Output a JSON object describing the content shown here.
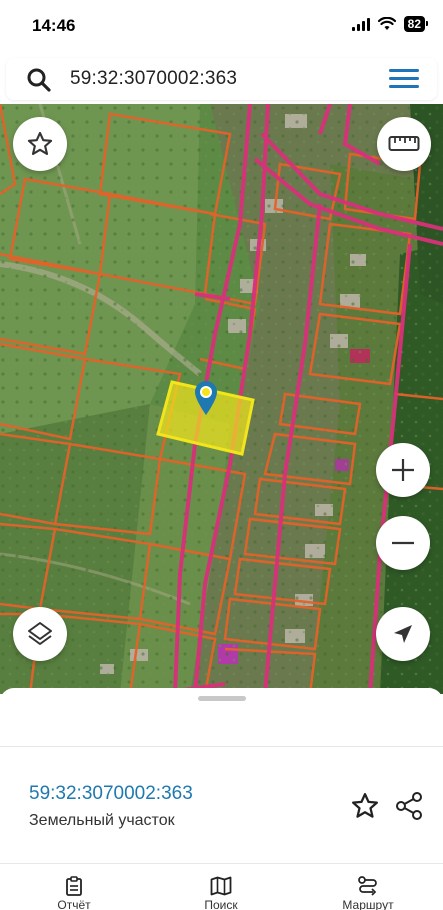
{
  "status_bar": {
    "time": "14:46",
    "battery": "82"
  },
  "search": {
    "query": "59:32:3070002:363",
    "search_icon": "search-icon",
    "menu_icon": "hamburger-menu-icon"
  },
  "map": {
    "controls": {
      "favorite": "star-icon",
      "ruler": "ruler-icon",
      "zoom_in": "plus-icon",
      "zoom_out": "minus-icon",
      "layers": "layers-icon",
      "locate": "navigation-arrow-icon"
    },
    "colors": {
      "parcel_border": "#e4622a",
      "road_border": "#d8317a",
      "selected_fill": "#f2e51c",
      "marker": "#1e79b0"
    }
  },
  "sheet": {
    "parcel_id": "59:32:3070002:363",
    "parcel_type": "Земельный участок",
    "favorite_icon": "star-outline-icon",
    "share_icon": "share-icon"
  },
  "tabs": [
    {
      "label": "Отчёт",
      "icon": "clipboard-icon"
    },
    {
      "label": "Поиск",
      "icon": "map-icon"
    },
    {
      "label": "Маршрут",
      "icon": "route-icon"
    }
  ]
}
